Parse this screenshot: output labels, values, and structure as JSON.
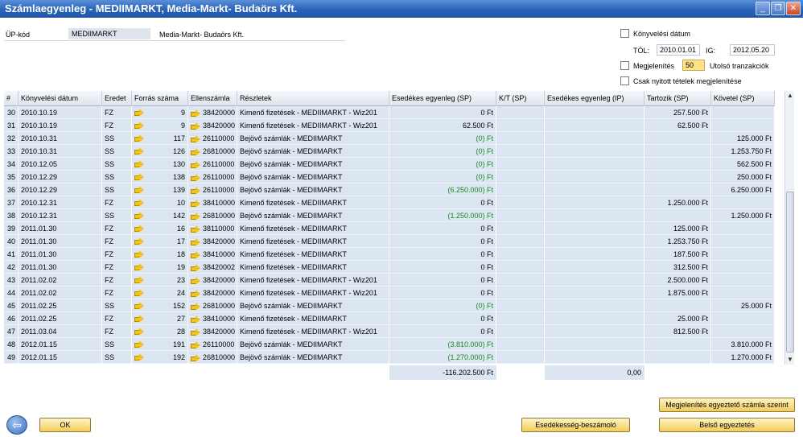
{
  "window": {
    "title": "Számlaegyenleg - MEDIIMARKT, Media-Markt- Budaörs Kft.",
    "minimize_label": "_",
    "restore_label": "❐",
    "close_label": "✕"
  },
  "header": {
    "up_kod_label": "ÜP-kód",
    "up_kod_value": "MEDIIMARKT",
    "partner_name": "Media-Markt- Budaörs Kft.",
    "konyvelesi_datum_label": "Könyvelési dátum",
    "tol_label": "TÓL:",
    "tol_value": "2010.01.01",
    "ig_label": "IG:",
    "ig_value": "2012.05.20",
    "megjelenites_label": "Megjelenítés",
    "megjelenites_value": "50",
    "utolso_label": "Utolsó tranzakciók",
    "csak_nyitott_label": "Csak nyitott tételek megjelenítése"
  },
  "table": {
    "columns": [
      "#",
      "Könyvelési dátum",
      "Eredet",
      "Forrás száma",
      "Ellenszámla",
      "Részletek",
      "Esedékes egyenleg (SP)",
      "K/T (SP)",
      "Esedékes egyenleg (IP)",
      "Tartozik (SP)",
      "Követel (SP)"
    ],
    "rows": [
      {
        "n": "30",
        "date": "2010.10.19",
        "src": "FZ",
        "num": "9",
        "acc": "38420000",
        "det": "Kimenő fizetések - MEDIIMARKT - Wiz201",
        "bal": "0 Ft",
        "green": false,
        "debit": "257.500 Ft",
        "credit": ""
      },
      {
        "n": "31",
        "date": "2010.10.19",
        "src": "FZ",
        "num": "9",
        "acc": "38420000",
        "det": "Kimenő fizetések - MEDIIMARKT - Wiz201",
        "bal": "62.500 Ft",
        "green": false,
        "debit": "62.500 Ft",
        "credit": ""
      },
      {
        "n": "32",
        "date": "2010.10.31",
        "src": "SS",
        "num": "117",
        "acc": "26110000",
        "det": "Bejövő számlák - MEDIIMARKT",
        "bal": "(0) Ft",
        "green": true,
        "debit": "",
        "credit": "125.000 Ft"
      },
      {
        "n": "33",
        "date": "2010.10.31",
        "src": "SS",
        "num": "126",
        "acc": "26810000",
        "det": "Bejövő számlák - MEDIIMARKT",
        "bal": "(0) Ft",
        "green": true,
        "debit": "",
        "credit": "1.253.750 Ft"
      },
      {
        "n": "34",
        "date": "2010.12.05",
        "src": "SS",
        "num": "130",
        "acc": "26110000",
        "det": "Bejövő számlák - MEDIIMARKT",
        "bal": "(0) Ft",
        "green": true,
        "debit": "",
        "credit": "562.500 Ft"
      },
      {
        "n": "35",
        "date": "2010.12.29",
        "src": "SS",
        "num": "138",
        "acc": "26110000",
        "det": "Bejövő számlák - MEDIIMARKT",
        "bal": "(0) Ft",
        "green": true,
        "debit": "",
        "credit": "250.000 Ft"
      },
      {
        "n": "36",
        "date": "2010.12.29",
        "src": "SS",
        "num": "139",
        "acc": "26110000",
        "det": "Bejövő számlák - MEDIIMARKT",
        "bal": "(6.250.000) Ft",
        "green": true,
        "debit": "",
        "credit": "6.250.000 Ft"
      },
      {
        "n": "37",
        "date": "2010.12.31",
        "src": "FZ",
        "num": "10",
        "acc": "38410000",
        "det": "Kimenő fizetések - MEDIIMARKT",
        "bal": "0 Ft",
        "green": false,
        "debit": "1.250.000 Ft",
        "credit": ""
      },
      {
        "n": "38",
        "date": "2010.12.31",
        "src": "SS",
        "num": "142",
        "acc": "26810000",
        "det": "Bejövő számlák - MEDIIMARKT",
        "bal": "(1.250.000) Ft",
        "green": true,
        "debit": "",
        "credit": "1.250.000 Ft"
      },
      {
        "n": "39",
        "date": "2011.01.30",
        "src": "FZ",
        "num": "16",
        "acc": "38110000",
        "det": "Kimenő fizetések - MEDIIMARKT",
        "bal": "0 Ft",
        "green": false,
        "debit": "125.000 Ft",
        "credit": ""
      },
      {
        "n": "40",
        "date": "2011.01.30",
        "src": "FZ",
        "num": "17",
        "acc": "38420000",
        "det": "Kimenő fizetések - MEDIIMARKT",
        "bal": "0 Ft",
        "green": false,
        "debit": "1.253.750 Ft",
        "credit": ""
      },
      {
        "n": "41",
        "date": "2011.01.30",
        "src": "FZ",
        "num": "18",
        "acc": "38410000",
        "det": "Kimenő fizetések - MEDIIMARKT",
        "bal": "0 Ft",
        "green": false,
        "debit": "187.500 Ft",
        "credit": ""
      },
      {
        "n": "42",
        "date": "2011.01.30",
        "src": "FZ",
        "num": "19",
        "acc": "38420002",
        "det": "Kimenő fizetések - MEDIIMARKT",
        "bal": "0 Ft",
        "green": false,
        "debit": "312.500 Ft",
        "credit": ""
      },
      {
        "n": "43",
        "date": "2011.02.02",
        "src": "FZ",
        "num": "23",
        "acc": "38420000",
        "det": "Kimenő fizetések - MEDIIMARKT - Wiz201",
        "bal": "0 Ft",
        "green": false,
        "debit": "2.500.000 Ft",
        "credit": ""
      },
      {
        "n": "44",
        "date": "2011.02.02",
        "src": "FZ",
        "num": "24",
        "acc": "38420000",
        "det": "Kimenő fizetések - MEDIIMARKT - Wiz201",
        "bal": "0 Ft",
        "green": false,
        "debit": "1.875.000 Ft",
        "credit": ""
      },
      {
        "n": "45",
        "date": "2011.02.25",
        "src": "SS",
        "num": "152",
        "acc": "26810000",
        "det": "Bejövő számlák - MEDIIMARKT",
        "bal": "(0) Ft",
        "green": true,
        "debit": "",
        "credit": "25.000 Ft"
      },
      {
        "n": "46",
        "date": "2011.02.25",
        "src": "FZ",
        "num": "27",
        "acc": "38410000",
        "det": "Kimenő fizetések - MEDIIMARKT",
        "bal": "0 Ft",
        "green": false,
        "debit": "25.000 Ft",
        "credit": ""
      },
      {
        "n": "47",
        "date": "2011.03.04",
        "src": "FZ",
        "num": "28",
        "acc": "38420000",
        "det": "Kimenő fizetések - MEDIIMARKT - Wiz201",
        "bal": "0 Ft",
        "green": false,
        "debit": "812.500 Ft",
        "credit": ""
      },
      {
        "n": "48",
        "date": "2012.01.15",
        "src": "SS",
        "num": "191",
        "acc": "26110000",
        "det": "Bejövő számlák - MEDIIMARKT",
        "bal": "(3.810.000) Ft",
        "green": true,
        "debit": "",
        "credit": "3.810.000 Ft"
      },
      {
        "n": "49",
        "date": "2012.01.15",
        "src": "SS",
        "num": "192",
        "acc": "26810000",
        "det": "Bejövő számlák - MEDIIMARKT",
        "bal": "(1.270.000) Ft",
        "green": true,
        "debit": "",
        "credit": "1.270.000 Ft"
      }
    ],
    "total_sp": "-116.202.500 Ft",
    "total_ip": "0,00"
  },
  "buttons": {
    "ok": "OK",
    "megjelenites_egyezteto": "Megjelenítés egyeztető számla szerint",
    "esedekesseg": "Esedékesség-beszámoló",
    "belso_egyeztetes": "Belső egyeztetés"
  },
  "colors": {
    "titlebar": "#2a63b8",
    "row_bg": "#dce6f3",
    "negative_green": "#1a8a1a",
    "button_yellow": "#f2cd5a"
  }
}
